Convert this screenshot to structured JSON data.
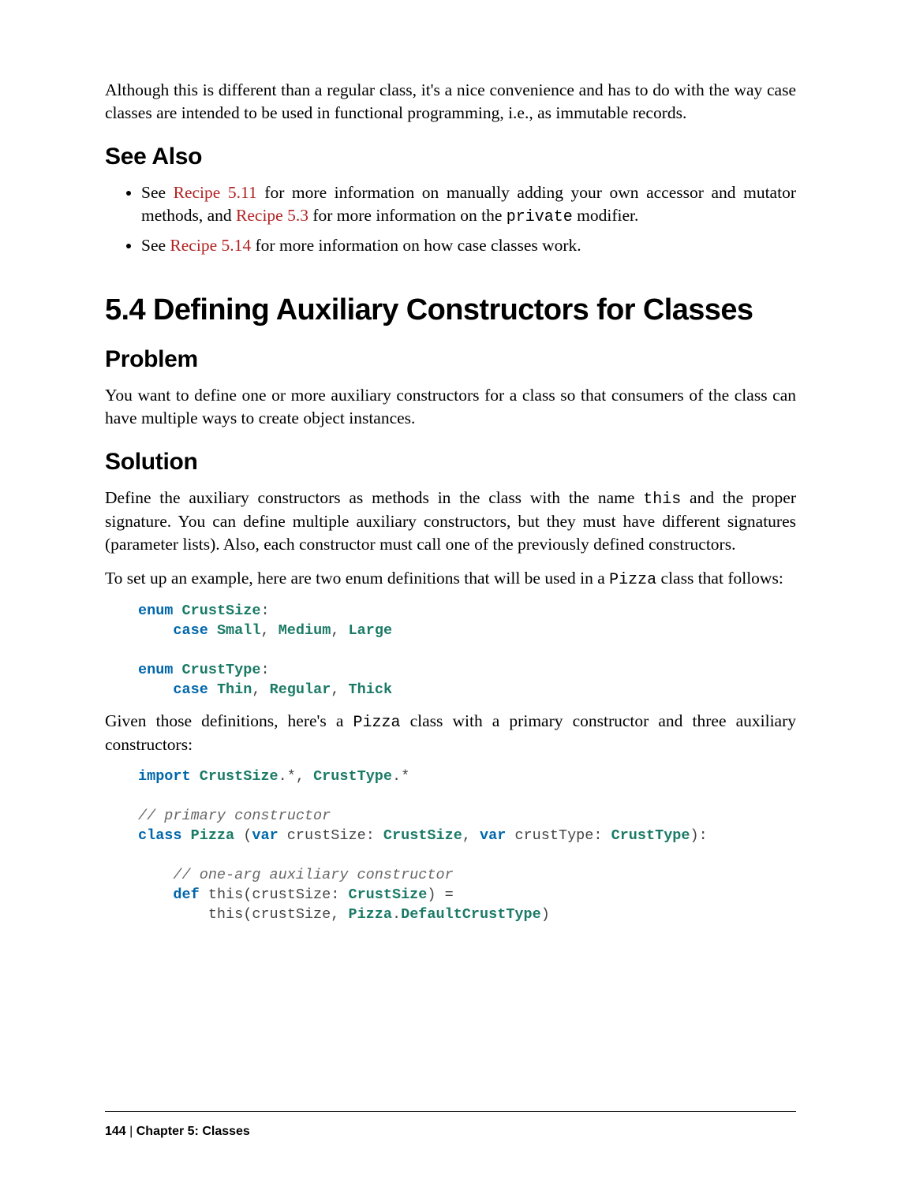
{
  "intro_para": "Although this is different than a regular class, it's a nice convenience and has to do with the way case classes are intended to be used in functional programming, i.e., as immutable records.",
  "see_also": {
    "heading": "See Also",
    "item1_a": "See ",
    "item1_link1": "Recipe 5.11",
    "item1_b": " for more information on manually adding your own accessor and mutator methods, and ",
    "item1_link2": "Recipe 5.3",
    "item1_c": " for more information on the ",
    "item1_code": "private",
    "item1_d": " modifier.",
    "item2_a": "See ",
    "item2_link": "Recipe 5.14",
    "item2_b": " for more information on how case classes work."
  },
  "section": {
    "heading": "5.4 Defining Auxiliary Constructors for Classes",
    "problem_h": "Problem",
    "problem_p": "You want to define one or more auxiliary constructors for a class so that consumers of the class can have multiple ways to create object instances.",
    "solution_h": "Solution",
    "solution_p1_a": "Define the auxiliary constructors as methods in the class with the name ",
    "solution_p1_code": "this",
    "solution_p1_b": " and the proper signature. You can define multiple auxiliary constructors, but they must have different signatures (parameter lists). Also, each constructor must call one of the previously defined constructors.",
    "solution_p2_a": "To set up an example, here are two enum definitions that will be used in a ",
    "solution_p2_code": "Pizza",
    "solution_p2_b": " class that follows:",
    "enum_code": {
      "l1_kw": "enum",
      "l1_t": "CrustSize",
      "l1_p": ":",
      "l2_kw": "case",
      "l2_v1": "Small",
      "l2_v2": "Medium",
      "l2_v3": "Large",
      "l3_kw": "enum",
      "l3_t": "CrustType",
      "l3_p": ":",
      "l4_kw": "case",
      "l4_v1": "Thin",
      "l4_v2": "Regular",
      "l4_v3": "Thick"
    },
    "solution_p3_a": "Given those definitions, here's a ",
    "solution_p3_code": "Pizza",
    "solution_p3_b": " class with a primary constructor and three auxiliary constructors:",
    "pizza_code": {
      "l1_kw": "import",
      "l1_t1": "CrustSize",
      "l1_d": ".*, ",
      "l1_t2": "CrustType",
      "l1_d2": ".*",
      "l2_c": "// primary constructor",
      "l3_kw1": "class",
      "l3_t1": "Pizza",
      "l3_p1": " (",
      "l3_kw2": "var",
      "l3_id1": " crustSize: ",
      "l3_t2": "CrustSize",
      "l3_p2": ", ",
      "l3_kw3": "var",
      "l3_id2": " crustType: ",
      "l3_t3": "CrustType",
      "l3_p3": "):",
      "l4_c": "// one-arg auxiliary constructor",
      "l5_kw": "def",
      "l5_id": " this(crustSize: ",
      "l5_t": "CrustSize",
      "l5_p": ") =",
      "l6_id1": "this(crustSize, ",
      "l6_t1": "Pizza",
      "l6_d": ".",
      "l6_t2": "DefaultCrustType",
      "l6_p": ")"
    }
  },
  "footer": {
    "page": "144",
    "sep": "   |   ",
    "chapter": "Chapter 5: Classes"
  }
}
